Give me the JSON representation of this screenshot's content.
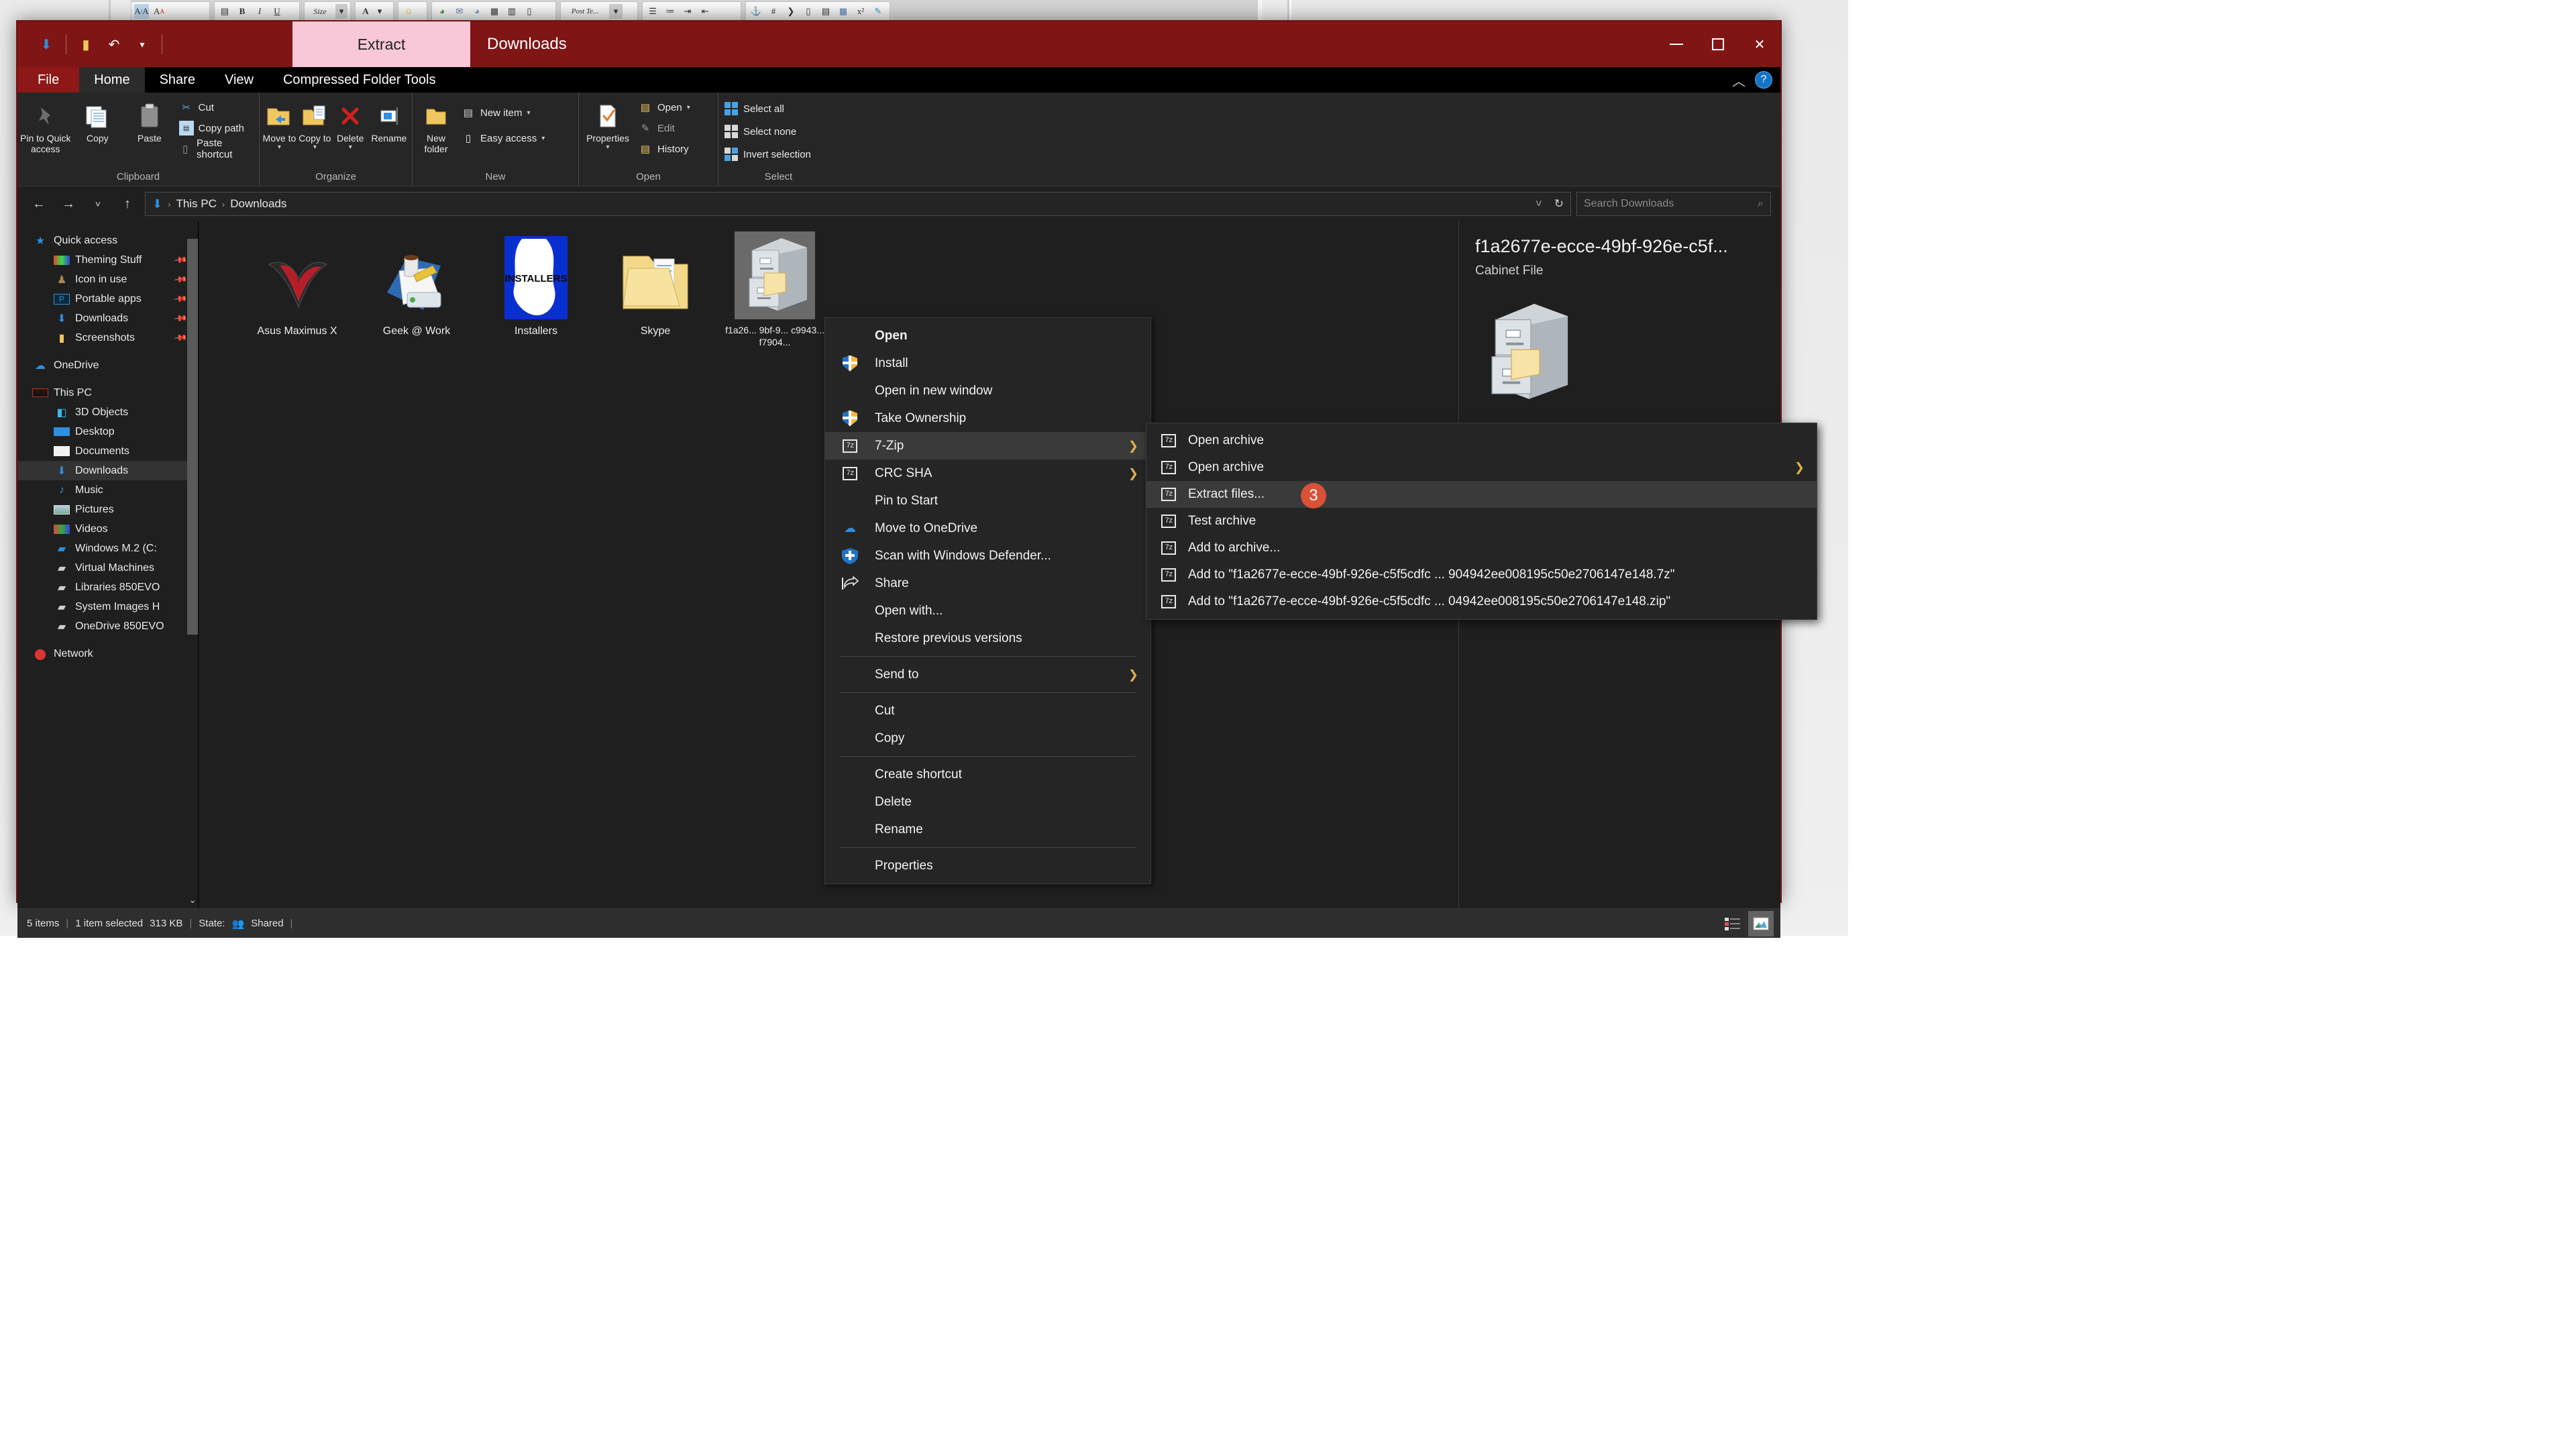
{
  "background_app": {
    "toolbar_buttons": [
      "A/A",
      "AA",
      "clipboard",
      "B",
      "I",
      "U",
      "Size",
      "A",
      "smiley",
      "globe",
      "envelope",
      "globe2",
      "grid",
      "film",
      "doc",
      "Post Te...",
      "list",
      "list2",
      "indent",
      "outdent",
      "anchor",
      "hash",
      "quote",
      "column",
      "lines",
      "chart",
      "x2",
      "brush"
    ]
  },
  "window": {
    "title": "Downloads",
    "quick_access_toolbar": [
      "down-arrow-icon",
      "folder-icon",
      "undo-icon",
      "dropdown-icon"
    ],
    "contextual_tab": "Extract",
    "controls": {
      "minimize": "—",
      "maximize": "□",
      "close": "✕"
    }
  },
  "ribbon": {
    "tabs": [
      "File",
      "Home",
      "Share",
      "View",
      "Compressed Folder Tools"
    ],
    "active_tab": "Home",
    "collapse_icon": "chevron-up-icon",
    "help_icon": "?",
    "groups": [
      {
        "label": "Clipboard",
        "big_buttons": [
          {
            "label": "Pin to Quick access",
            "icon": "pin-icon"
          },
          {
            "label": "Copy",
            "icon": "copy-icon"
          },
          {
            "label": "Paste",
            "icon": "paste-icon"
          }
        ],
        "small_buttons": [
          {
            "label": "Cut",
            "icon": "scissors-icon"
          },
          {
            "label": "Copy path",
            "icon": "copy-path-icon"
          },
          {
            "label": "Paste shortcut",
            "icon": "paste-shortcut-icon"
          }
        ]
      },
      {
        "label": "Organize",
        "big_buttons": [
          {
            "label": "Move to",
            "icon": "move-to-icon",
            "caret": true
          },
          {
            "label": "Copy to",
            "icon": "copy-to-icon",
            "caret": true
          },
          {
            "label": "Delete",
            "icon": "delete-icon",
            "caret": true
          },
          {
            "label": "Rename",
            "icon": "rename-icon"
          }
        ],
        "small_buttons": []
      },
      {
        "label": "New",
        "big_buttons": [
          {
            "label": "New folder",
            "icon": "new-folder-icon"
          }
        ],
        "small_buttons": [
          {
            "label": "New item",
            "icon": "new-item-icon",
            "caret": true
          },
          {
            "label": "Easy access",
            "icon": "easy-access-icon",
            "caret": true
          }
        ]
      },
      {
        "label": "Open",
        "big_buttons": [
          {
            "label": "Properties",
            "icon": "properties-icon",
            "caret": true
          }
        ],
        "small_buttons": [
          {
            "label": "Open",
            "icon": "open-folder-icon",
            "caret": true
          },
          {
            "label": "Edit",
            "icon": "edit-icon"
          },
          {
            "label": "History",
            "icon": "history-icon"
          }
        ]
      },
      {
        "label": "Select",
        "big_buttons": [],
        "small_buttons": [
          {
            "label": "Select all",
            "icon": "select-all-icon"
          },
          {
            "label": "Select none",
            "icon": "select-none-icon"
          },
          {
            "label": "Invert selection",
            "icon": "invert-selection-icon"
          }
        ]
      }
    ]
  },
  "addressbar": {
    "back": "←",
    "forward": "→",
    "recent": "˅",
    "up": "↑",
    "path_icon": "downloads-icon",
    "breadcrumbs": [
      "This PC",
      "Downloads"
    ],
    "dropdown": "˅",
    "refresh": "↻",
    "search_placeholder": "Search Downloads",
    "search_icon": "search-icon"
  },
  "navpane": {
    "groups": [
      {
        "root": {
          "label": "Quick access",
          "icon": "star-icon"
        },
        "items": [
          {
            "label": "Theming Stuff",
            "icon": "theming-icon",
            "pinned": true
          },
          {
            "label": "Icon in use",
            "icon": "icon-in-use-icon",
            "pinned": true
          },
          {
            "label": "Portable apps",
            "icon": "portable-apps-icon",
            "pinned": true
          },
          {
            "label": "Downloads",
            "icon": "downloads-icon",
            "pinned": true
          },
          {
            "label": "Screenshots",
            "icon": "folder-icon",
            "pinned": true
          }
        ]
      },
      {
        "root": {
          "label": "OneDrive",
          "icon": "onedrive-icon"
        },
        "items": []
      },
      {
        "root": {
          "label": "This PC",
          "icon": "this-pc-icon"
        },
        "items": [
          {
            "label": "3D Objects",
            "icon": "3d-objects-icon"
          },
          {
            "label": "Desktop",
            "icon": "desktop-icon"
          },
          {
            "label": "Documents",
            "icon": "documents-icon"
          },
          {
            "label": "Downloads",
            "icon": "downloads-icon",
            "selected": true
          },
          {
            "label": "Music",
            "icon": "music-icon"
          },
          {
            "label": "Pictures",
            "icon": "pictures-icon"
          },
          {
            "label": "Videos",
            "icon": "videos-icon"
          },
          {
            "label": "Windows M.2 (C:",
            "icon": "windows-drive-icon"
          },
          {
            "label": "Virtual Machines",
            "icon": "drive-icon"
          },
          {
            "label": "Libraries 850EVO",
            "icon": "drive-icon"
          },
          {
            "label": "System Images H",
            "icon": "drive-icon"
          },
          {
            "label": "OneDrive 850EVO",
            "icon": "drive-icon"
          }
        ]
      },
      {
        "root": {
          "label": "Network",
          "icon": "network-icon"
        },
        "items": []
      }
    ],
    "scroll_down_icon": "chevron-down-icon"
  },
  "files": [
    {
      "name": "Asus Maximus X",
      "icon": "asus-rog-icon"
    },
    {
      "name": "Geek @ Work",
      "icon": "geek-at-work-icon"
    },
    {
      "name": "Installers",
      "icon": "installers-icon"
    },
    {
      "name": "Skype",
      "icon": "folder-icon"
    },
    {
      "name": "f1a26... 9bf-9... c9943... f7904...",
      "icon": "cabinet-file-icon",
      "selected": true
    }
  ],
  "details_pane": {
    "title": "f1a2677e-ecce-49bf-926e-c5f...",
    "subtitle": "Cabinet File",
    "icon": "cabinet-file-icon"
  },
  "statusbar": {
    "item_count": "5 items",
    "selection": "1 item selected",
    "size": "313 KB",
    "state_label": "State:",
    "state_value": "Shared",
    "state_icon": "shared-icon",
    "view_buttons": [
      {
        "name": "details-view",
        "active": false
      },
      {
        "name": "large-icons-view",
        "active": true
      }
    ]
  },
  "context_menu": {
    "items": [
      {
        "label": "Open",
        "bold": true,
        "icon": null
      },
      {
        "label": "Install",
        "icon": "shield-icon"
      },
      {
        "label": "Open in new window",
        "icon": null
      },
      {
        "label": "Take Ownership",
        "icon": "shield-icon"
      },
      {
        "label": "7-Zip",
        "icon": "7zip-icon",
        "submenu": true,
        "highlighted": true
      },
      {
        "label": "CRC SHA",
        "icon": "7zip-icon",
        "submenu": true
      },
      {
        "label": "Pin to Start",
        "icon": null
      },
      {
        "label": "Move to OneDrive",
        "icon": "onedrive-icon"
      },
      {
        "label": "Scan with Windows Defender...",
        "icon": "defender-icon"
      },
      {
        "label": "Share",
        "icon": "share-icon"
      },
      {
        "label": "Open with...",
        "icon": null
      },
      {
        "label": "Restore previous versions",
        "icon": null
      },
      {
        "separator": true
      },
      {
        "label": "Send to",
        "icon": null,
        "submenu": true
      },
      {
        "separator": true
      },
      {
        "label": "Cut",
        "icon": null
      },
      {
        "label": "Copy",
        "icon": null
      },
      {
        "separator": true
      },
      {
        "label": "Create shortcut",
        "icon": null
      },
      {
        "label": "Delete",
        "icon": null
      },
      {
        "label": "Rename",
        "icon": null
      },
      {
        "separator": true
      },
      {
        "label": "Properties",
        "icon": null
      }
    ]
  },
  "submenu_7zip": {
    "items": [
      {
        "label": "Open archive",
        "icon": "7zip-icon"
      },
      {
        "label": "Open archive",
        "icon": "7zip-icon",
        "submenu": true
      },
      {
        "label": "Extract files...",
        "icon": "7zip-icon",
        "highlighted": true
      },
      {
        "label": "Test archive",
        "icon": "7zip-icon"
      },
      {
        "label": "Add to archive...",
        "icon": "7zip-icon"
      },
      {
        "label": "Add to \"f1a2677e-ecce-49bf-926e-c5f5cdfc ... 904942ee008195c50e2706147e148.7z\"",
        "icon": "7zip-icon"
      },
      {
        "label": "Add to \"f1a2677e-ecce-49bf-926e-c5f5cdfc ... 04942ee008195c50e2706147e148.zip\"",
        "icon": "7zip-icon"
      }
    ]
  },
  "annotation_badge": {
    "number": "3"
  },
  "colors": {
    "titlebar": "#801515",
    "contextual_tab": "#f8c8d8",
    "window_border": "#6e1212",
    "menu_bg": "#252525",
    "menu_highlight": "#3a3a3a",
    "badge": "#da5138",
    "accent_blue": "#1273c9"
  }
}
